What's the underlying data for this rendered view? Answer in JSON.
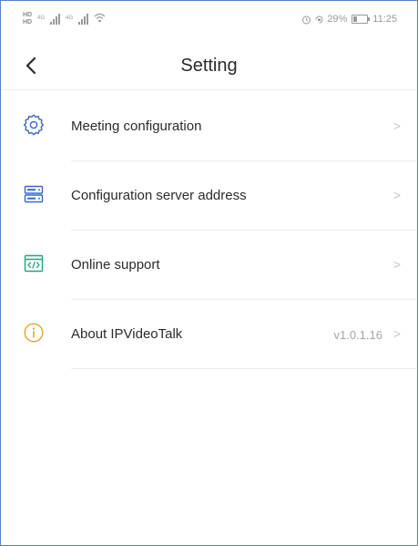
{
  "status_bar": {
    "sim_top": "HD",
    "sim_bottom": "HD",
    "sim1_tag": "4G",
    "sim2_tag": "4G",
    "battery_text": "29%",
    "time": "11:25"
  },
  "header": {
    "title": "Setting"
  },
  "settings": {
    "items": [
      {
        "label": "Meeting configuration",
        "value": "",
        "icon": "gear-icon",
        "color": "#3a66c9"
      },
      {
        "label": "Configuration server address",
        "value": "",
        "icon": "server-icon",
        "color": "#3a66c9"
      },
      {
        "label": "Online support",
        "value": "",
        "icon": "code-window-icon",
        "color": "#2e9e83"
      },
      {
        "label": "About IPVideoTalk",
        "value": "v1.0.1.16",
        "icon": "info-icon",
        "color": "#e0a43a"
      }
    ]
  },
  "colors": {
    "border": "#4f86c6",
    "text_primary": "#2b2b2b",
    "text_secondary": "#a6a6a6",
    "divider": "#ececec"
  }
}
